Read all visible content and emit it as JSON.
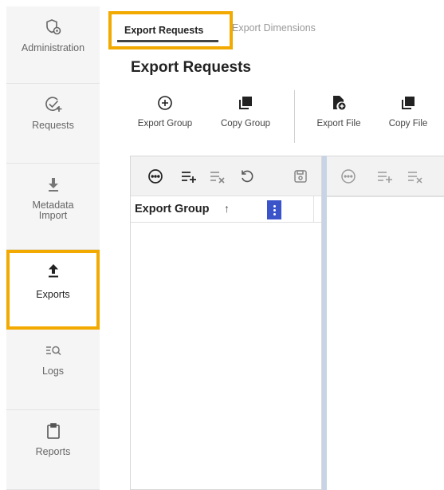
{
  "sidebar": {
    "items": [
      {
        "label": "Administration",
        "icon": "admin-shield-icon",
        "active": false
      },
      {
        "label": "Requests",
        "icon": "check-add-icon",
        "active": false
      },
      {
        "label": "Metadata Import",
        "icon": "download-icon",
        "active": false
      },
      {
        "label": "Exports",
        "icon": "upload-icon",
        "active": true
      },
      {
        "label": "Logs",
        "icon": "log-search-icon",
        "active": false
      },
      {
        "label": "Reports",
        "icon": "clipboard-icon",
        "active": false
      }
    ]
  },
  "tabs": [
    {
      "label": "Export Requests",
      "active": true
    },
    {
      "label": "Export Dimensions",
      "active": false
    }
  ],
  "page": {
    "title": "Export Requests"
  },
  "toolbar": {
    "export_group": "Export Group",
    "copy_group": "Copy Group",
    "export_file": "Export File",
    "copy_file": "Copy File"
  },
  "grid_left": {
    "column_header": "Export Group",
    "sort_glyph": "↑",
    "rows": []
  },
  "colors": {
    "highlight": "#f2a900",
    "column_menu": "#3b54c9",
    "splitter": "#c8d4e6",
    "sidebar_bg": "#f5f5f5"
  }
}
